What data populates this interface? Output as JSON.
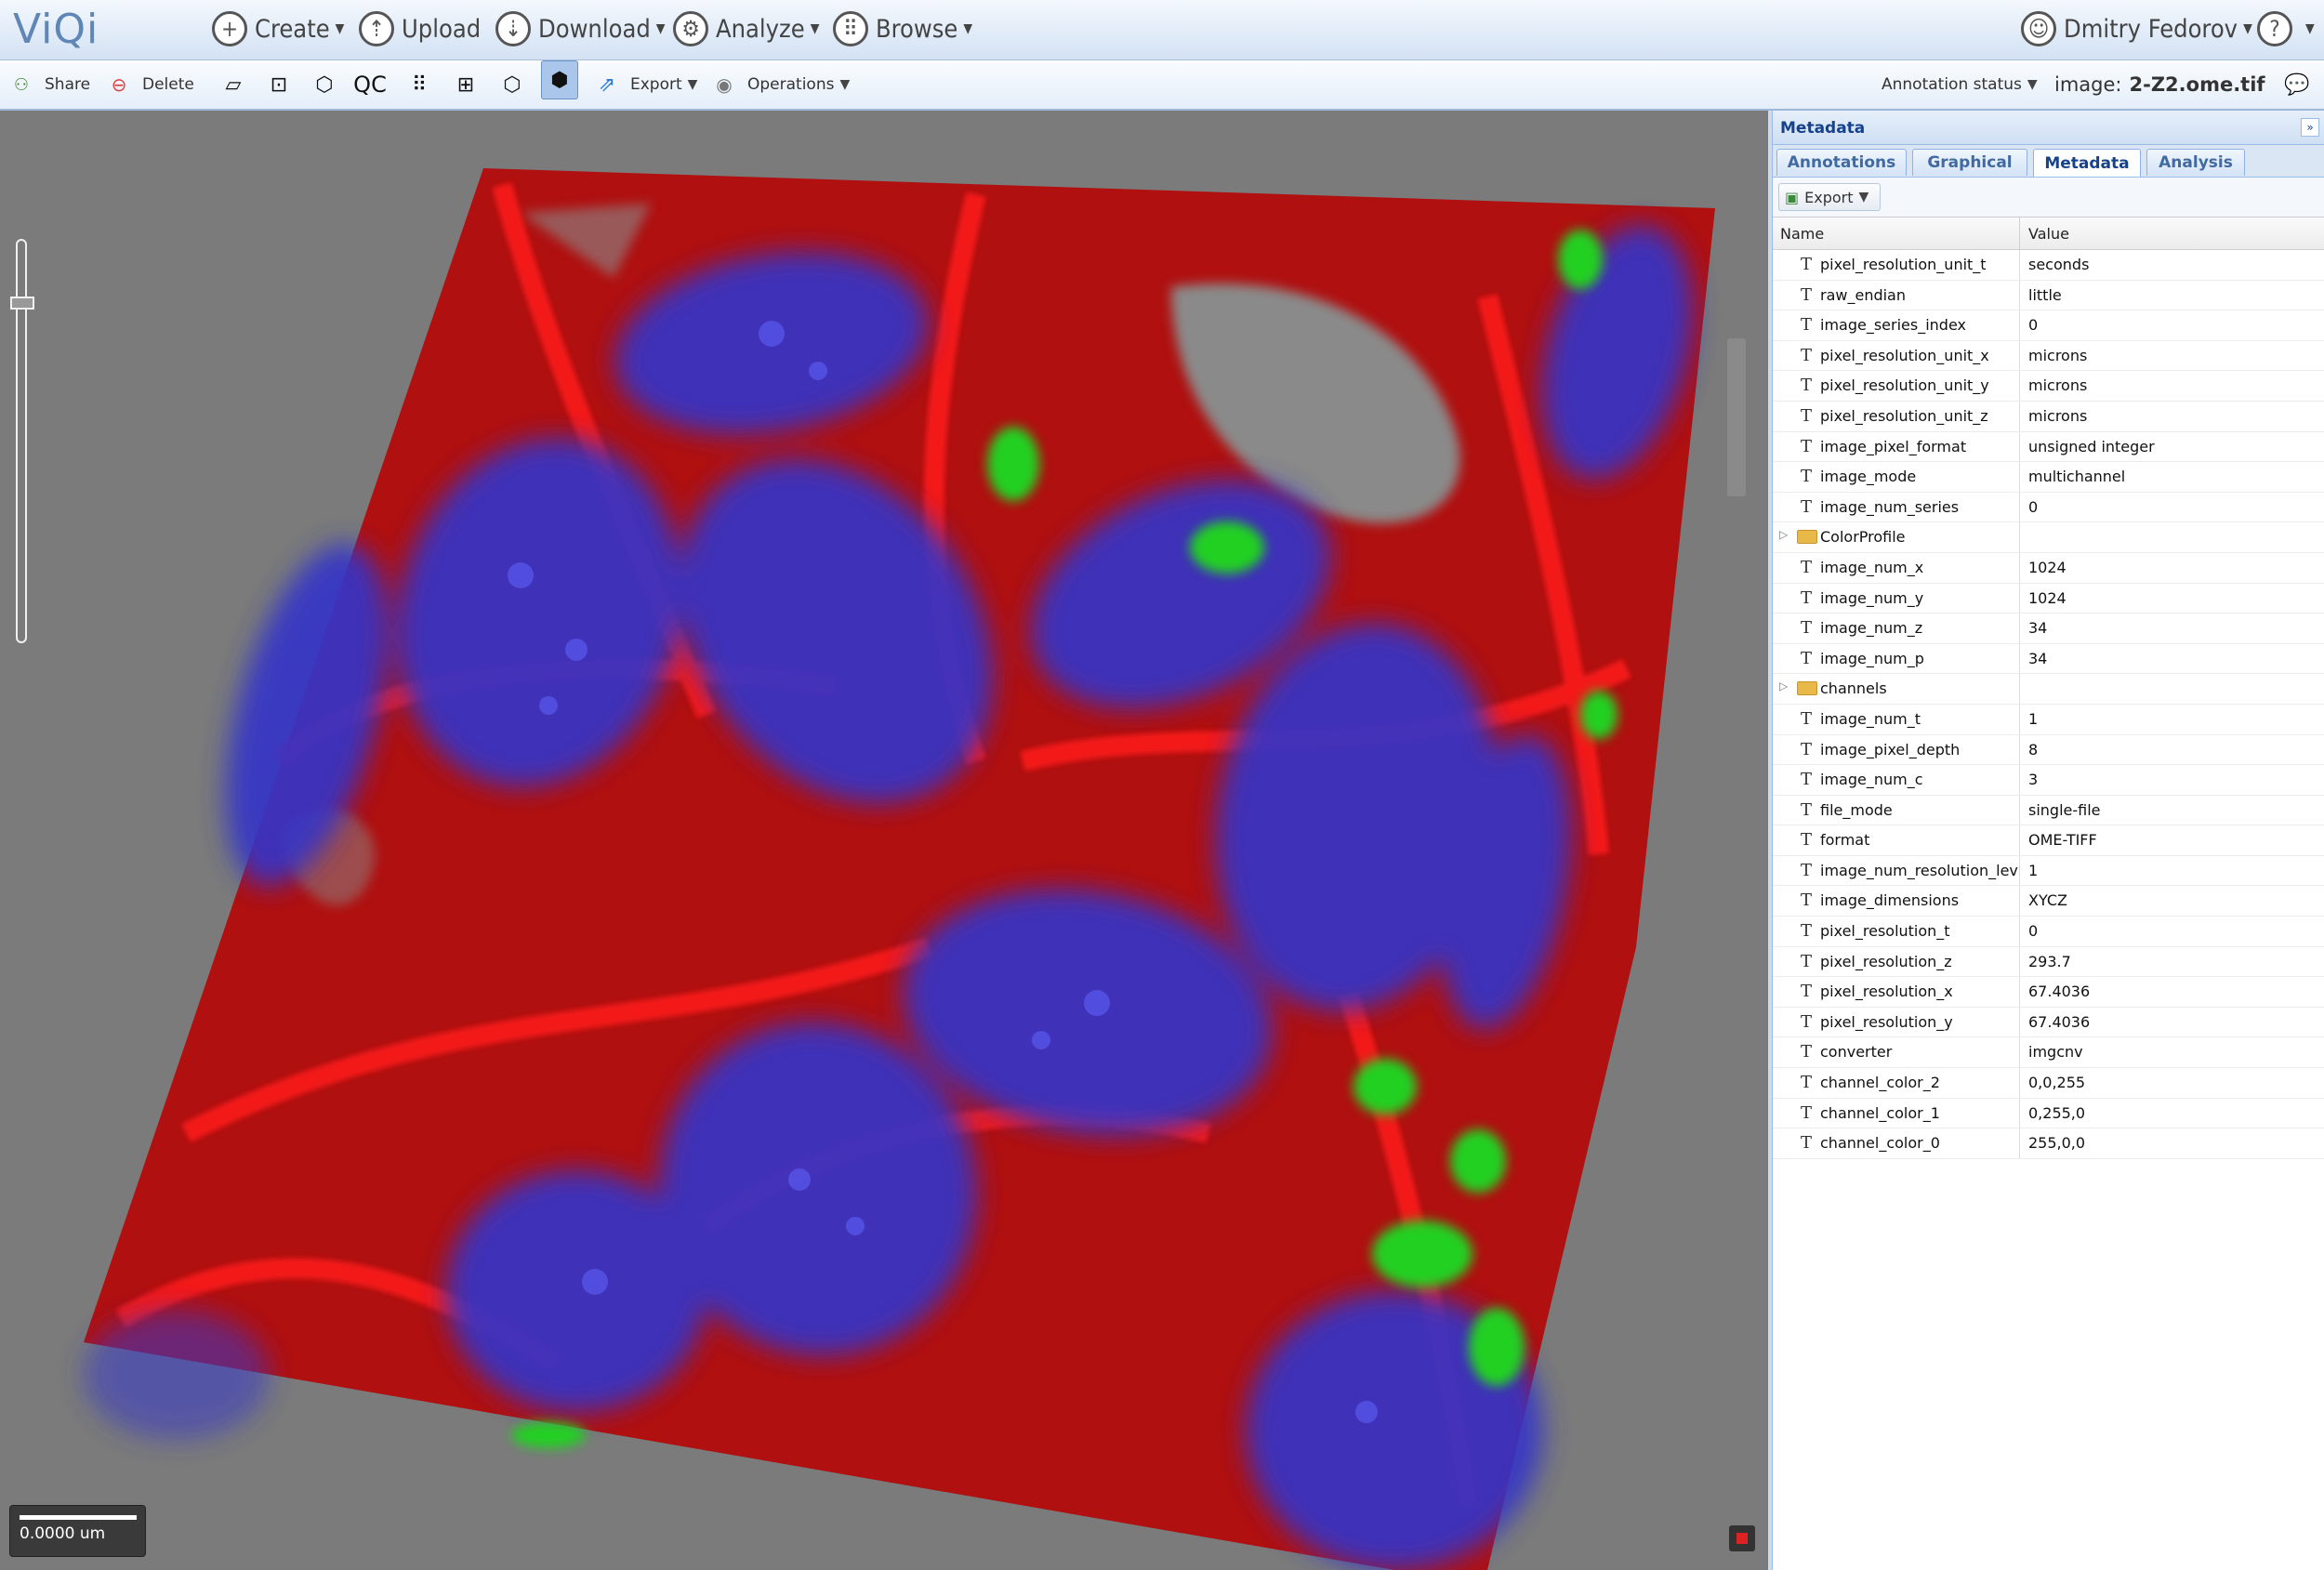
{
  "app": {
    "logo": "ViQi"
  },
  "nav": {
    "create": "Create",
    "upload": "Upload",
    "download": "Download",
    "analyze": "Analyze",
    "browse": "Browse",
    "user": "Dmitry Fedorov",
    "help": "?"
  },
  "toolbar": {
    "share": "Share",
    "delete": "Delete",
    "qc": "QC",
    "export": "Export",
    "operations": "Operations",
    "annotation_status": "Annotation status",
    "image_prefix": "image:",
    "image_name": "2-Z2.ome.tif"
  },
  "viewer": {
    "scale_label": "0.0000 um"
  },
  "panel": {
    "title": "Metadata",
    "tabs": [
      "Annotations",
      "Graphical",
      "Metadata",
      "Analysis"
    ],
    "active_tab": "Metadata",
    "export_label": "Export",
    "col_name": "Name",
    "col_value": "Value",
    "rows": [
      {
        "type": "text",
        "name": "pixel_resolution_unit_t",
        "value": "seconds"
      },
      {
        "type": "text",
        "name": "raw_endian",
        "value": "little"
      },
      {
        "type": "text",
        "name": "image_series_index",
        "value": "0"
      },
      {
        "type": "text",
        "name": "pixel_resolution_unit_x",
        "value": "microns"
      },
      {
        "type": "text",
        "name": "pixel_resolution_unit_y",
        "value": "microns"
      },
      {
        "type": "text",
        "name": "pixel_resolution_unit_z",
        "value": "microns"
      },
      {
        "type": "text",
        "name": "image_pixel_format",
        "value": "unsigned integer"
      },
      {
        "type": "text",
        "name": "image_mode",
        "value": "multichannel"
      },
      {
        "type": "text",
        "name": "image_num_series",
        "value": "0"
      },
      {
        "type": "folder",
        "name": "ColorProfile",
        "value": ""
      },
      {
        "type": "text",
        "name": "image_num_x",
        "value": "1024"
      },
      {
        "type": "text",
        "name": "image_num_y",
        "value": "1024"
      },
      {
        "type": "text",
        "name": "image_num_z",
        "value": "34"
      },
      {
        "type": "text",
        "name": "image_num_p",
        "value": "34"
      },
      {
        "type": "folder",
        "name": "channels",
        "value": ""
      },
      {
        "type": "text",
        "name": "image_num_t",
        "value": "1"
      },
      {
        "type": "text",
        "name": "image_pixel_depth",
        "value": "8"
      },
      {
        "type": "text",
        "name": "image_num_c",
        "value": "3"
      },
      {
        "type": "text",
        "name": "file_mode",
        "value": "single-file"
      },
      {
        "type": "text",
        "name": "format",
        "value": "OME-TIFF"
      },
      {
        "type": "text",
        "name": "image_num_resolution_lev",
        "value": "1"
      },
      {
        "type": "text",
        "name": "image_dimensions",
        "value": "XYCZ"
      },
      {
        "type": "text",
        "name": "pixel_resolution_t",
        "value": "0"
      },
      {
        "type": "text",
        "name": "pixel_resolution_z",
        "value": "293.7"
      },
      {
        "type": "text",
        "name": "pixel_resolution_x",
        "value": "67.4036"
      },
      {
        "type": "text",
        "name": "pixel_resolution_y",
        "value": "67.4036"
      },
      {
        "type": "text",
        "name": "converter",
        "value": "imgcnv"
      },
      {
        "type": "text",
        "name": "channel_color_2",
        "value": "0,0,255"
      },
      {
        "type": "text",
        "name": "channel_color_1",
        "value": "0,255,0"
      },
      {
        "type": "text",
        "name": "channel_color_0",
        "value": "255,0,0"
      }
    ]
  },
  "colors": {
    "brand": "#5f86b5",
    "panel_header": "#15428b",
    "channel_red": "#e81010",
    "channel_blue": "#3a3ad8",
    "channel_green": "#22d022"
  }
}
